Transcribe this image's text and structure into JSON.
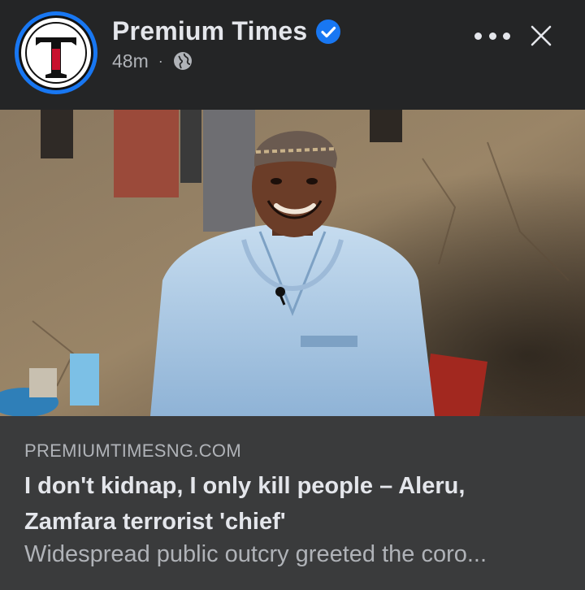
{
  "header": {
    "page_name": "Premium Times",
    "timestamp": "48m",
    "separator": "·",
    "avatar_icon": "premium-times-logo",
    "verified_icon": "verified-badge-icon",
    "audience_icon": "globe-icon",
    "more_icon": "more-options-icon",
    "close_icon": "close-icon"
  },
  "photo": {
    "alt": "photo-preview"
  },
  "link": {
    "domain": "PREMIUMTIMESNG.COM",
    "title": "I don't kidnap, I only kill people – Aleru, Zamfara terrorist 'chief'",
    "description": "Widespread public outcry greeted the coro..."
  },
  "colors": {
    "background": "#242526",
    "link_box": "#3a3b3c",
    "primary_text": "#e4e6eb",
    "secondary_text": "#b0b3b8",
    "accent": "#1877f2"
  }
}
